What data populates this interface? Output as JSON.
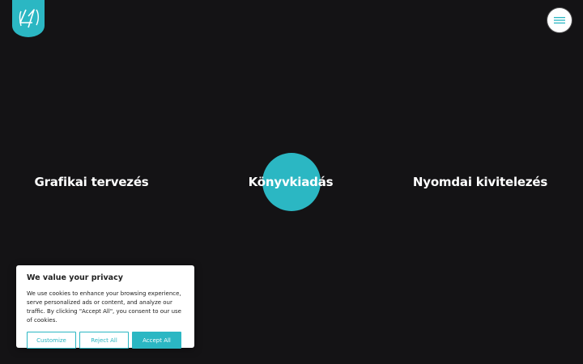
{
  "header": {
    "logo_icon": "shield-logo-icon",
    "menu_icon": "hamburger-menu-icon"
  },
  "main": {
    "items": [
      {
        "label": "Grafikai tervezés"
      },
      {
        "label": "Könyvkiadás"
      },
      {
        "label": "Nyomdai kivitelezés"
      }
    ],
    "accent_color": "#2bb7c3"
  },
  "cookie_banner": {
    "title": "We value your privacy",
    "text": "We use cookies to enhance your browsing experience, serve personalized ads or content, and analyze our traffic. By clicking \"Accept All\", you consent to our use of cookies.",
    "buttons": {
      "customize": "Customize",
      "reject": "Reject All",
      "accept": "Accept All"
    }
  }
}
